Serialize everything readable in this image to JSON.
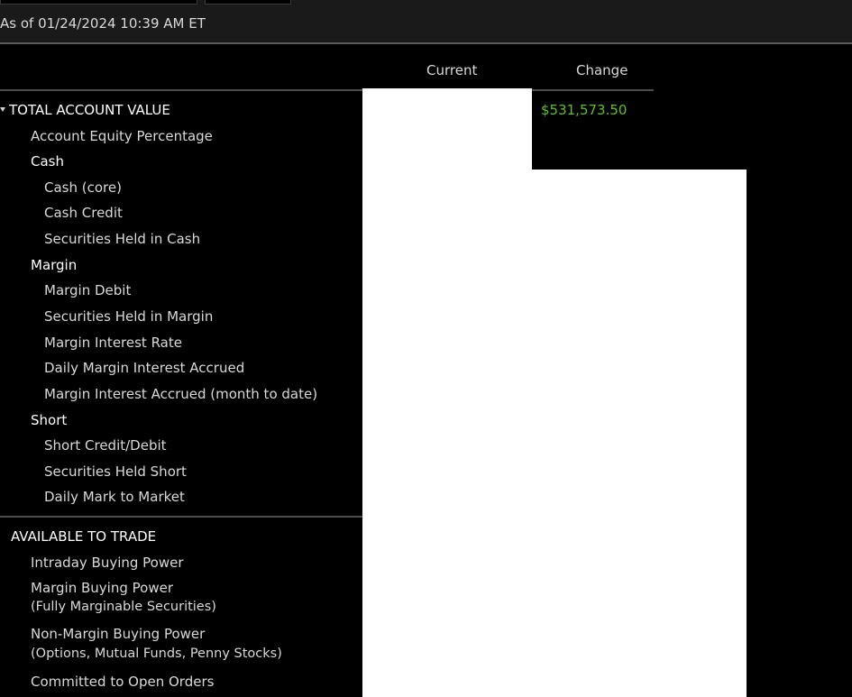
{
  "as_of": "As of 01/24/2024 10:39 AM ET",
  "columns": {
    "current": "Current",
    "change": "Change"
  },
  "total_account_value": {
    "label": "TOTAL ACCOUNT VALUE",
    "change": "$531,573.50",
    "change_color": "#5fc026",
    "items": {
      "account_equity": "Account Equity Percentage",
      "cash": "Cash",
      "cash_core": "Cash (core)",
      "cash_credit": "Cash Credit",
      "sec_held_cash": "Securities Held in Cash",
      "margin": "Margin",
      "margin_debit": "Margin Debit",
      "sec_held_margin": "Securities Held in Margin",
      "margin_interest_rate": "Margin Interest Rate",
      "daily_margin_interest": "Daily Margin Interest Accrued",
      "margin_interest_mtd": "Margin Interest Accrued (month to date)",
      "short": "Short",
      "short_credit_debit": "Short Credit/Debit",
      "sec_held_short": "Securities Held Short",
      "daily_mtm": "Daily Mark to Market"
    }
  },
  "available_to_trade": {
    "label": "AVAILABLE TO TRADE",
    "items": {
      "intraday_bp": "Intraday Buying Power",
      "margin_bp": "Margin Buying Power",
      "margin_bp_sub": "(Fully Marginable Securities)",
      "non_margin_bp": "Non-Margin Buying Power",
      "non_margin_bp_sub": "(Options, Mutual Funds, Penny Stocks)",
      "committed_orders": "Committed to Open Orders"
    }
  }
}
